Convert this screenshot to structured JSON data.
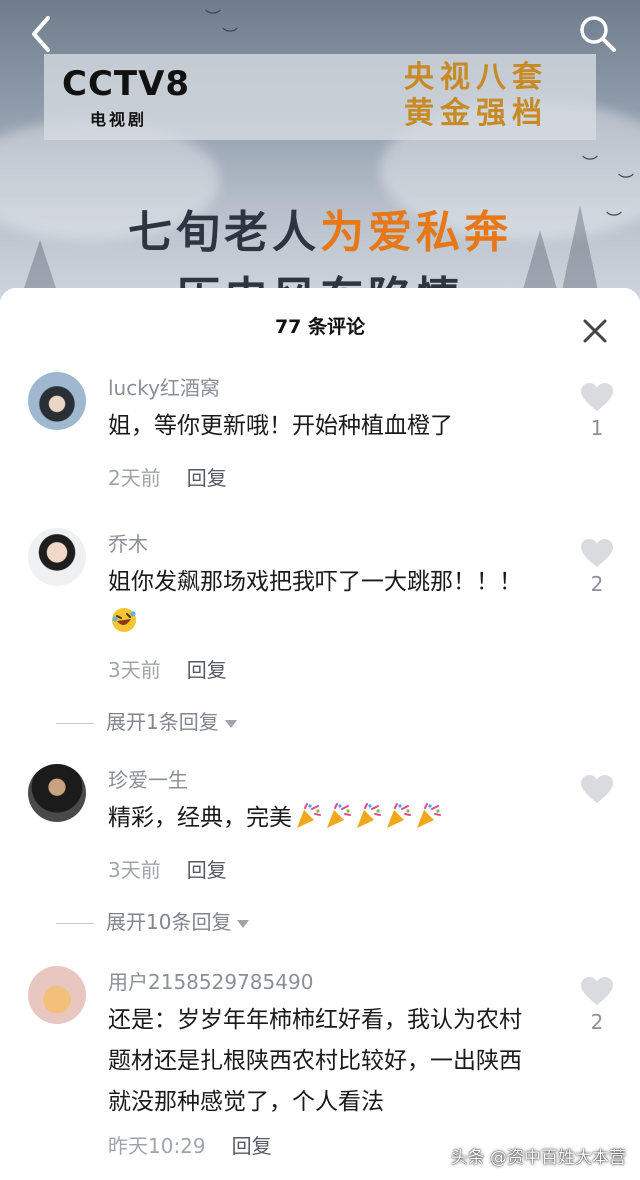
{
  "video": {
    "channel_logo": "CCTV8",
    "channel_sub": "电视剧",
    "promo_line1": "央视八套",
    "promo_line2": "黄金强档",
    "headline_part1": "七旬老人",
    "headline_part2": "为爱私奔",
    "headline_line2": "历史风东陷情"
  },
  "comments_header": {
    "count": "77",
    "label": "条评论"
  },
  "comments": [
    {
      "username": "lucky红酒窝",
      "text": "姐，等你更新哦！开始种植血橙了",
      "time": "2天前",
      "reply": "回复",
      "likes": "1"
    },
    {
      "username": "乔木",
      "text": "姐你发飙那场戏把我吓了一大跳那！！！",
      "time": "3天前",
      "reply": "回复",
      "likes": "2",
      "expand": "展开1条回复"
    },
    {
      "username": "珍爱一生",
      "text": "精彩，经典，完美",
      "time": "3天前",
      "reply": "回复",
      "likes": "",
      "expand": "展开10条回复"
    },
    {
      "username": "用户2158529785490",
      "text": "还是：岁岁年年柿柿红好看，我认为农村题材还是扎根陕西农村比较好，一出陕西就没那种感觉了，个人看法",
      "time": "昨天10:29",
      "reply": "回复",
      "likes": "2"
    }
  ],
  "watermark": "头条 @资中百姓大本营",
  "colors": {
    "accent_orange": "#e67817",
    "promo_gold": "#c88a24",
    "like_gray": "#d9dbdf"
  },
  "icons": [
    "back-arrow-icon",
    "search-icon",
    "close-icon",
    "heart-icon",
    "party-popper-emoji",
    "laughing-emoji"
  ]
}
